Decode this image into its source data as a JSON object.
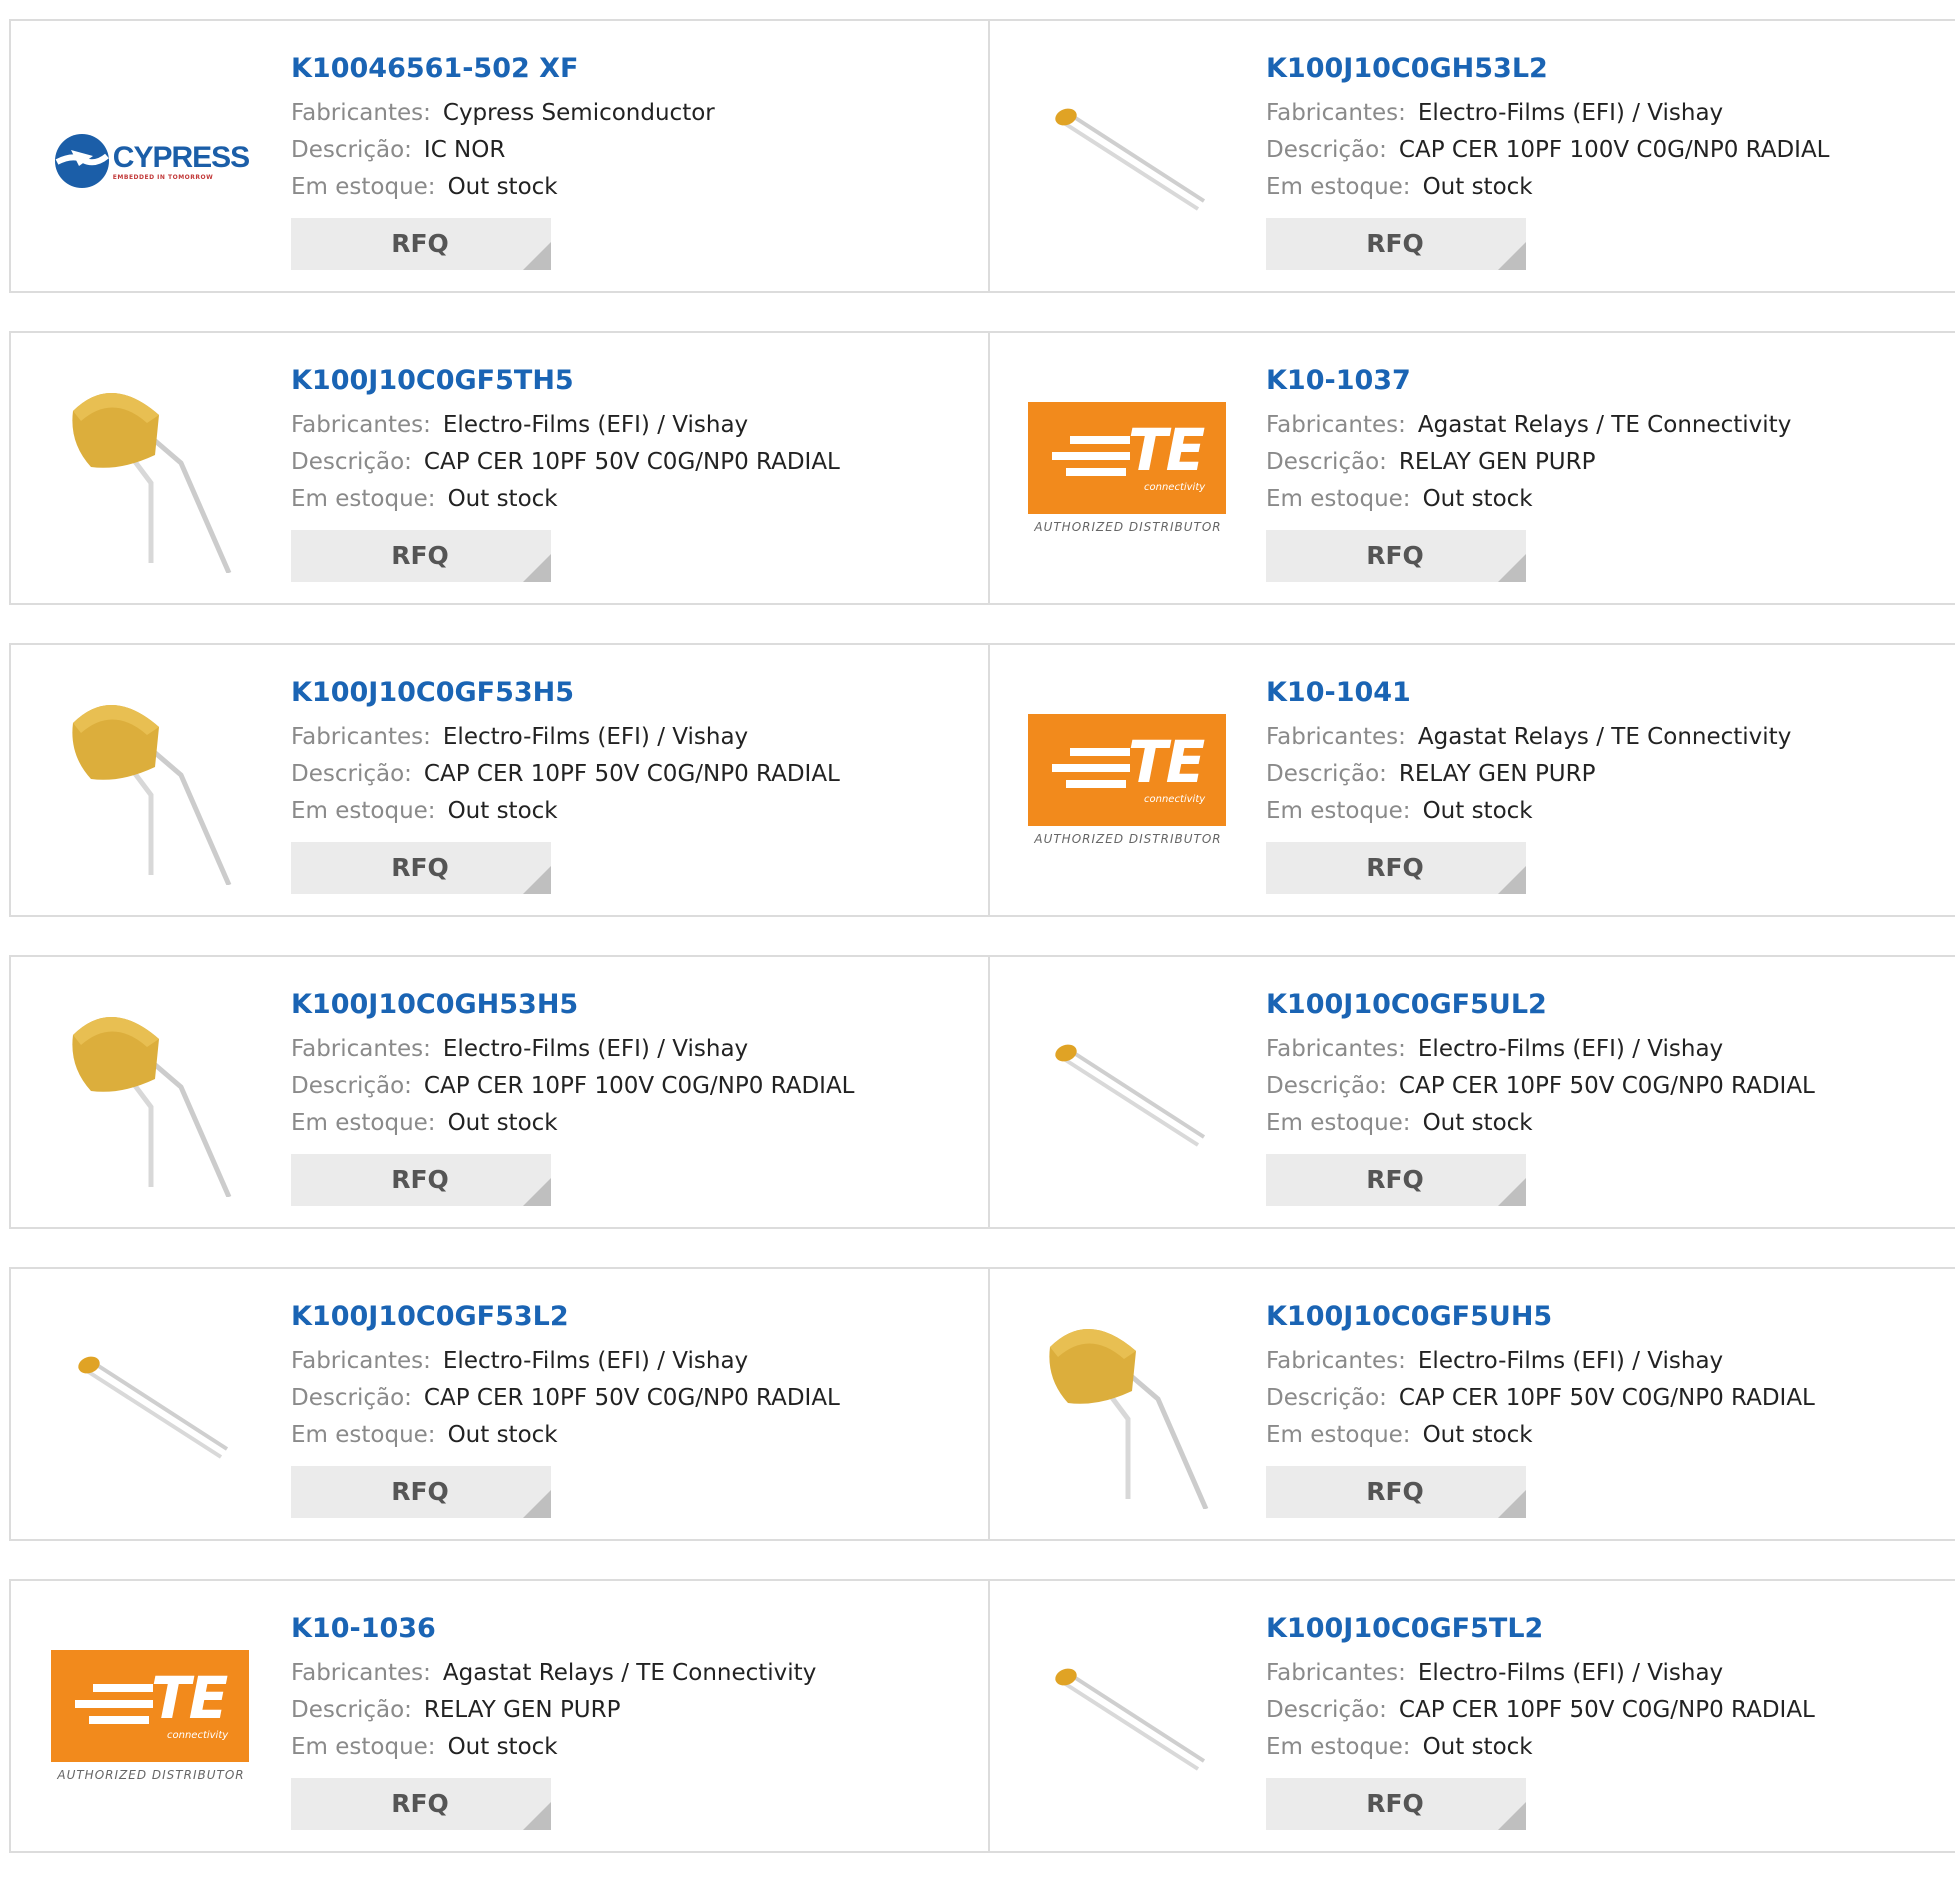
{
  "labels": {
    "manufacturer": "Fabricantes:",
    "description": "Descrição:",
    "stock": "Em estoque:",
    "rfq": "RFQ"
  },
  "logos": {
    "cypress_name": "CYPRESS",
    "cypress_tagline": "EMBEDDED IN TOMORROW",
    "te_name": "TE",
    "te_sub": "connectivity",
    "te_auth": "AUTHORIZED DISTRIBUTOR"
  },
  "products": [
    {
      "pn": "K10046561-502 XF",
      "mfr": "Cypress Semiconductor",
      "desc": "IC NOR",
      "stock": "Out stock",
      "image": "cypress-logo"
    },
    {
      "pn": "K100J10C0GH53L2",
      "mfr": "Electro-Films (EFI) / Vishay",
      "desc": "CAP CER 10PF 100V C0G/NP0 RADIAL",
      "stock": "Out stock",
      "image": "small-capacitor"
    },
    {
      "pn": "K100J10C0GF5TH5",
      "mfr": "Electro-Films (EFI) / Vishay",
      "desc": "CAP CER 10PF 50V C0G/NP0 RADIAL",
      "stock": "Out stock",
      "image": "large-capacitor"
    },
    {
      "pn": "K10-1037",
      "mfr": "Agastat Relays / TE Connectivity",
      "desc": "RELAY GEN PURP",
      "stock": "Out stock",
      "image": "te-logo"
    },
    {
      "pn": "K100J10C0GF53H5",
      "mfr": "Electro-Films (EFI) / Vishay",
      "desc": "CAP CER 10PF 50V C0G/NP0 RADIAL",
      "stock": "Out stock",
      "image": "large-capacitor"
    },
    {
      "pn": "K10-1041",
      "mfr": "Agastat Relays / TE Connectivity",
      "desc": "RELAY GEN PURP",
      "stock": "Out stock",
      "image": "te-logo"
    },
    {
      "pn": "K100J10C0GH53H5",
      "mfr": "Electro-Films (EFI) / Vishay",
      "desc": "CAP CER 10PF 100V C0G/NP0 RADIAL",
      "stock": "Out stock",
      "image": "large-capacitor"
    },
    {
      "pn": "K100J10C0GF5UL2",
      "mfr": "Electro-Films (EFI) / Vishay",
      "desc": "CAP CER 10PF 50V C0G/NP0 RADIAL",
      "stock": "Out stock",
      "image": "small-capacitor"
    },
    {
      "pn": "K100J10C0GF53L2",
      "mfr": "Electro-Films (EFI) / Vishay",
      "desc": "CAP CER 10PF 50V C0G/NP0 RADIAL",
      "stock": "Out stock",
      "image": "small-capacitor"
    },
    {
      "pn": "K100J10C0GF5UH5",
      "mfr": "Electro-Films (EFI) / Vishay",
      "desc": "CAP CER 10PF 50V C0G/NP0 RADIAL",
      "stock": "Out stock",
      "image": "large-capacitor"
    },
    {
      "pn": "K10-1036",
      "mfr": "Agastat Relays / TE Connectivity",
      "desc": "RELAY GEN PURP",
      "stock": "Out stock",
      "image": "te-logo"
    },
    {
      "pn": "K100J10C0GF5TL2",
      "mfr": "Electro-Films (EFI) / Vishay",
      "desc": "CAP CER 10PF 50V C0G/NP0 RADIAL",
      "stock": "Out stock",
      "image": "small-capacitor"
    }
  ]
}
